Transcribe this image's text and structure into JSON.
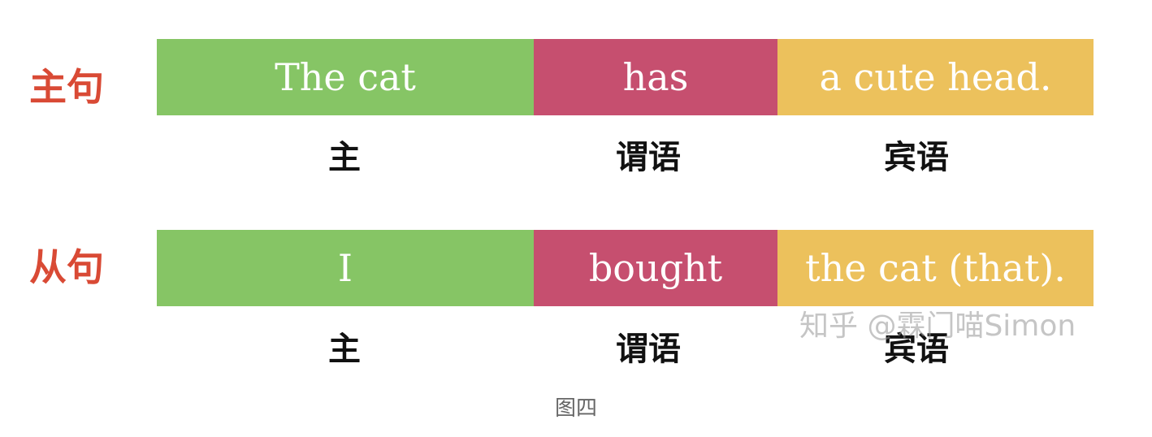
{
  "colors": {
    "label": "#d94a35",
    "subject": "#86c565",
    "verb": "#c64f6f",
    "object": "#ecc15c"
  },
  "rows": [
    {
      "label": "主句",
      "subject": "The cat",
      "verb": "has",
      "object": "a cute head.",
      "roles": {
        "subject": "主",
        "verb": "谓语",
        "object": "宾语"
      }
    },
    {
      "label": "从句",
      "subject": "I",
      "verb": "bought",
      "object": "the cat (that).",
      "roles": {
        "subject": "主",
        "verb": "谓语",
        "object": "宾语"
      }
    }
  ],
  "watermark": "知乎 @霖门喵Simon",
  "caption": "图四"
}
